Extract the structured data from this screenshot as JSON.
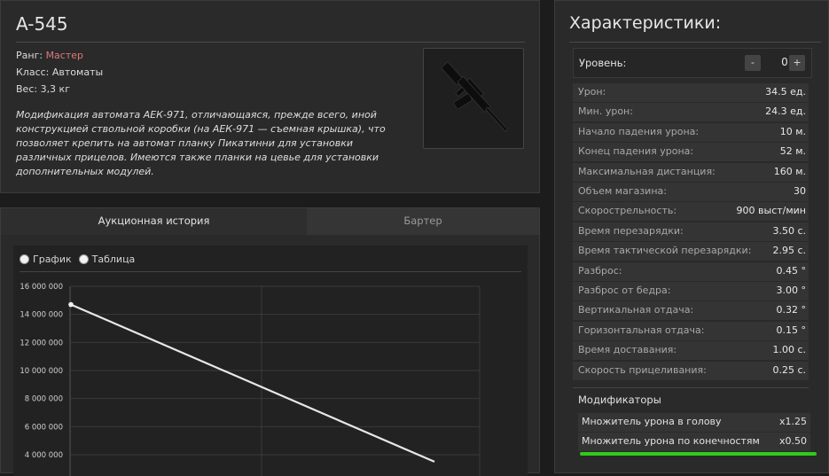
{
  "item": {
    "name": "A-545",
    "rank_label": "Ранг: ",
    "rank_value": "Мастер",
    "class_text": "Класс: Автоматы",
    "weight_text": "Вес: 3,3 кг",
    "description": "Модификация автомата АЕК-971, отличающаяся, прежде всего, иной конструкцией ствольной коробки (на АЕК-971 — съемная крышка), что позволяет крепить на автомат планку Пикатинни для установки различных прицелов. Имеются также планки на цевье для установки дополнительных модулей."
  },
  "auction": {
    "tabs": [
      {
        "label": "Аукционная история",
        "active": true
      },
      {
        "label": "Бартер",
        "active": false
      }
    ],
    "view_options": [
      "График",
      "Таблица"
    ]
  },
  "chart_data": {
    "type": "line",
    "y_ticks": [
      "16 000 000",
      "14 000 000",
      "12 000 000",
      "10 000 000",
      "8 000 000",
      "6 000 000",
      "4 000 000"
    ],
    "y_tick_values": [
      16000000,
      14000000,
      12000000,
      10000000,
      8000000,
      6000000,
      4000000
    ],
    "ylim": [
      4000000,
      16000000
    ],
    "series": [
      {
        "points": [
          {
            "x": 0,
            "y": 14700000
          },
          {
            "x": 1,
            "y": 3500000
          }
        ]
      }
    ],
    "grid": true,
    "line_color": "#e8e8e8"
  },
  "characteristics": {
    "title": "Характеристики:",
    "level": {
      "label": "Уровень:",
      "value": "0",
      "minus": "-",
      "plus": "+"
    },
    "stats": [
      {
        "label": "Урон:",
        "value": "34.5 ед."
      },
      {
        "label": "Мин. урон:",
        "value": "24.3 ед."
      },
      {
        "label": "Начало падения урона:",
        "value": "10 м."
      },
      {
        "label": "Конец падения урона:",
        "value": "52 м."
      },
      {
        "label": "Максимальная дистанция:",
        "value": "160 м."
      },
      {
        "label": "Объем магазина:",
        "value": "30"
      },
      {
        "label": "Скорострельность:",
        "value": "900 выст/мин"
      },
      {
        "label": "Время перезарядки:",
        "value": "3.50 с."
      },
      {
        "label": "Время тактической перезарядки:",
        "value": "2.95 с."
      },
      {
        "label": "Разброс:",
        "value": "0.45 °"
      },
      {
        "label": "Разброс от бедра:",
        "value": "3.00 °"
      },
      {
        "label": "Вертикальная отдача:",
        "value": "0.32 °"
      },
      {
        "label": "Горизонтальная отдача:",
        "value": "0.15 °"
      },
      {
        "label": "Время доставания:",
        "value": "1.00 с."
      },
      {
        "label": "Скорость прицеливания:",
        "value": "0.25 с."
      }
    ],
    "modifiers_title": "Модификаторы",
    "modifiers": [
      {
        "label": "Множитель урона в голову",
        "value": "x1.25"
      },
      {
        "label": "Множитель урона по конечностям",
        "value": "x0.50"
      }
    ]
  },
  "colors": {
    "rank": "#e07878",
    "scrollbar": "#2ecc1a"
  }
}
